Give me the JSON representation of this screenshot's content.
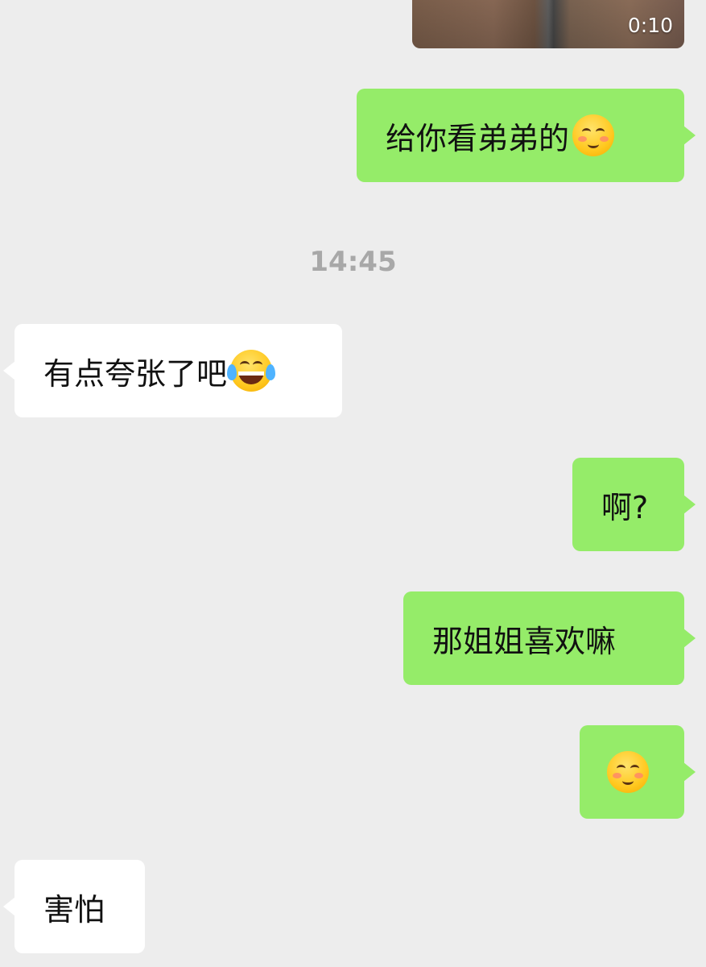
{
  "chat": {
    "video": {
      "duration": "0:10"
    },
    "timestamp": "14:45",
    "messages": [
      {
        "direction": "out",
        "text": "给你看弟弟的",
        "emoji": "blushing-smile-emoji"
      },
      {
        "direction": "in",
        "text": "有点夸张了吧",
        "emoji": "tears-of-joy-emoji"
      },
      {
        "direction": "out",
        "text": "啊?"
      },
      {
        "direction": "out",
        "text": "那姐姐喜欢嘛"
      },
      {
        "direction": "out",
        "text": "",
        "emoji": "blushing-smile-emoji"
      },
      {
        "direction": "in",
        "text": "害怕"
      }
    ]
  },
  "colors": {
    "background": "#ededed",
    "outgoing_bubble": "#95ec69",
    "incoming_bubble": "#ffffff",
    "timestamp": "#a8a8a8"
  }
}
